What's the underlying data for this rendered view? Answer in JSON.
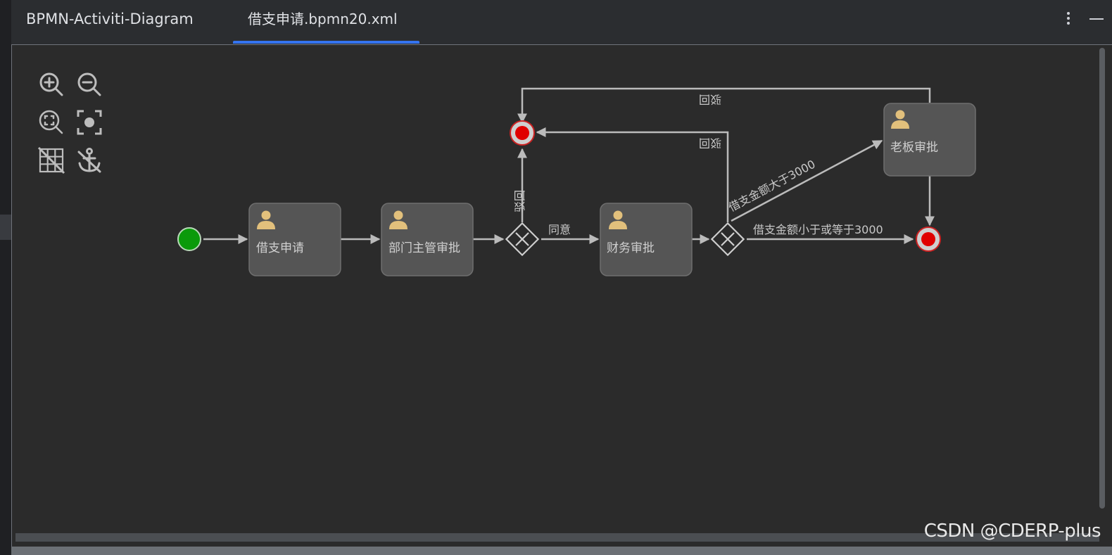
{
  "tool_window": {
    "title": "BPMN-Activiti-Diagram",
    "tab_label": "借支申请.bpmn20.xml"
  },
  "toolbar": {
    "icons": [
      "zoom-in-icon",
      "zoom-out-icon",
      "zoom-to-fit-icon",
      "center-focus-icon",
      "grid-toggle-icon",
      "anchor-icon"
    ]
  },
  "diagram": {
    "tasks": {
      "apply": "借支申请",
      "dept_manager": "部门主管审批",
      "finance": "财务审批",
      "boss": "老板审批"
    },
    "flows": {
      "agree": "同意",
      "reject_from_manager": "驳回",
      "reject_from_finance": "驳回",
      "reject_from_boss": "驳回",
      "amount_gt_3000": "借支金额大于3000",
      "amount_le_3000": "借支金额小于或等于3000"
    },
    "colors": {
      "start_event": "#0a9a0a",
      "end_event": "#e00000",
      "task_fill": "#555555",
      "task_icon": "#e2c07c",
      "connector": "#bbbbbb"
    }
  },
  "watermark": "CSDN @CDERP-plus"
}
